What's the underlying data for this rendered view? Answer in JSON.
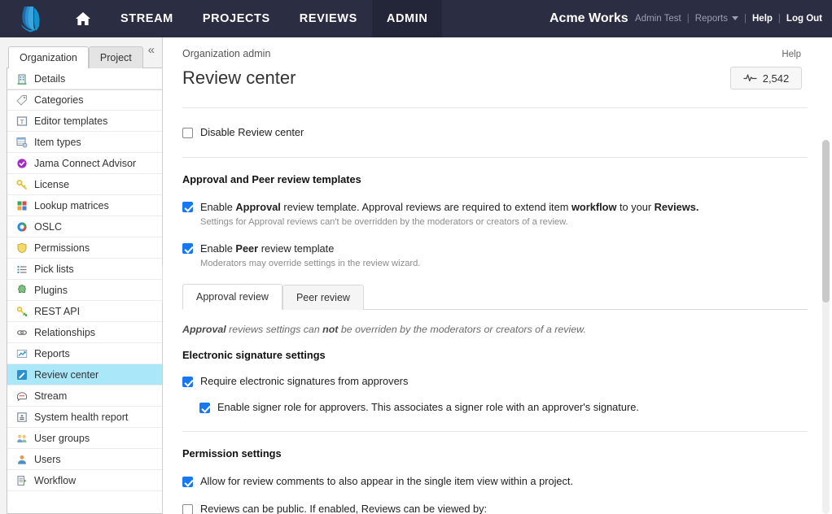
{
  "topnav": {
    "logo_icon": "jama-logo-icon",
    "home_icon": "home-icon",
    "items": [
      {
        "label": "STREAM",
        "name": "nav-stream",
        "active": false
      },
      {
        "label": "PROJECTS",
        "name": "nav-projects",
        "active": false
      },
      {
        "label": "REVIEWS",
        "name": "nav-reviews",
        "active": false
      },
      {
        "label": "ADMIN",
        "name": "nav-admin",
        "active": true
      }
    ],
    "org_name": "Acme Works",
    "account": {
      "user": "Admin Test",
      "reports": "Reports",
      "help": "Help",
      "logout": "Log Out",
      "separator": "|"
    },
    "colors": {
      "bar": "#2b2d42",
      "active_tab": "#232538"
    }
  },
  "sidebar": {
    "tabs": [
      {
        "label": "Organization",
        "active": true
      },
      {
        "label": "Project",
        "active": false
      }
    ],
    "collapse_icon": "chevron-double-left-icon",
    "items": [
      {
        "label": "Details",
        "icon": "building-icon",
        "selected": false,
        "gap_after": true
      },
      {
        "label": "Categories",
        "icon": "tag-icon",
        "selected": false
      },
      {
        "label": "Editor templates",
        "icon": "text-box-icon",
        "selected": false
      },
      {
        "label": "Item types",
        "icon": "table-gear-icon",
        "selected": false
      },
      {
        "label": "Jama Connect Advisor",
        "icon": "purple-check-badge-icon",
        "selected": false
      },
      {
        "label": "License",
        "icon": "key-icon",
        "selected": false
      },
      {
        "label": "Lookup matrices",
        "icon": "color-grid-icon",
        "selected": false
      },
      {
        "label": "OSLC",
        "icon": "oslc-ring-icon",
        "selected": false
      },
      {
        "label": "Permissions",
        "icon": "shield-icon",
        "selected": false
      },
      {
        "label": "Pick lists",
        "icon": "list-icon",
        "selected": false
      },
      {
        "label": "Plugins",
        "icon": "puzzle-icon",
        "selected": false
      },
      {
        "label": "REST API",
        "icon": "key-arrow-icon",
        "selected": false
      },
      {
        "label": "Relationships",
        "icon": "chain-link-icon",
        "selected": false
      },
      {
        "label": "Reports",
        "icon": "chart-icon",
        "selected": false
      },
      {
        "label": "Review center",
        "icon": "pencil-icon",
        "selected": true
      },
      {
        "label": "Stream",
        "icon": "speech-bubble-icon",
        "selected": false
      },
      {
        "label": "System health report",
        "icon": "report-box-icon",
        "selected": false
      },
      {
        "label": "User groups",
        "icon": "users-group-icon",
        "selected": false
      },
      {
        "label": "Users",
        "icon": "user-icon",
        "selected": false
      },
      {
        "label": "Workflow",
        "icon": "workflow-doc-icon",
        "selected": false
      }
    ],
    "selected_color": "#a9e7f9",
    "splitter_name": "sidebar-splitter-handle"
  },
  "main": {
    "breadcrumb": "Organization admin",
    "help_link": "Help",
    "page_title": "Review center",
    "health_badge": {
      "value": "2,542",
      "icon": "pulse-icon"
    },
    "disable_checkbox": {
      "label": "Disable Review center",
      "checked": false
    },
    "templates_section": {
      "heading": "Approval and Peer review templates",
      "approval": {
        "checked": true,
        "label_parts": [
          {
            "text": "Enable ",
            "bold": false
          },
          {
            "text": "Approval",
            "bold": true
          },
          {
            "text": " review template. Approval reviews are required to extend item ",
            "bold": false
          },
          {
            "text": "workflow",
            "bold": true
          },
          {
            "text": " to your ",
            "bold": false
          },
          {
            "text": "Reviews.",
            "bold": true
          }
        ],
        "sub": "Settings for Approval reviews can't be overridden by the moderators or creators of a review."
      },
      "peer": {
        "checked": true,
        "label_parts": [
          {
            "text": "Enable ",
            "bold": false
          },
          {
            "text": "Peer",
            "bold": true
          },
          {
            "text": " review template",
            "bold": false
          }
        ],
        "sub": "Moderators may override settings in the review wizard."
      }
    },
    "content_tabs": [
      {
        "label": "Approval review",
        "active": true
      },
      {
        "label": "Peer review",
        "active": false
      }
    ],
    "note_parts": [
      {
        "text": "Approval",
        "bold": true
      },
      {
        "text": " reviews settings can ",
        "bold": false
      },
      {
        "text": "not",
        "bold": true
      },
      {
        "text": " be overriden by the moderators or creators of a review.",
        "bold": false
      }
    ],
    "esig_section": {
      "heading": "Electronic signature settings",
      "require": {
        "label": "Require electronic signatures from approvers",
        "checked": true
      },
      "signer_role": {
        "label": "Enable signer role for approvers. This associates a signer role with an approver's signature.",
        "checked": true
      }
    },
    "permission_section": {
      "heading": "Permission settings",
      "comments": {
        "label": "Allow for review comments to also appear in the single item view within a project.",
        "checked": true
      },
      "public": {
        "label": "Reviews can be public. If enabled, Reviews can be viewed by:",
        "checked": false
      }
    },
    "accent_checked_color": "#1778f2"
  }
}
